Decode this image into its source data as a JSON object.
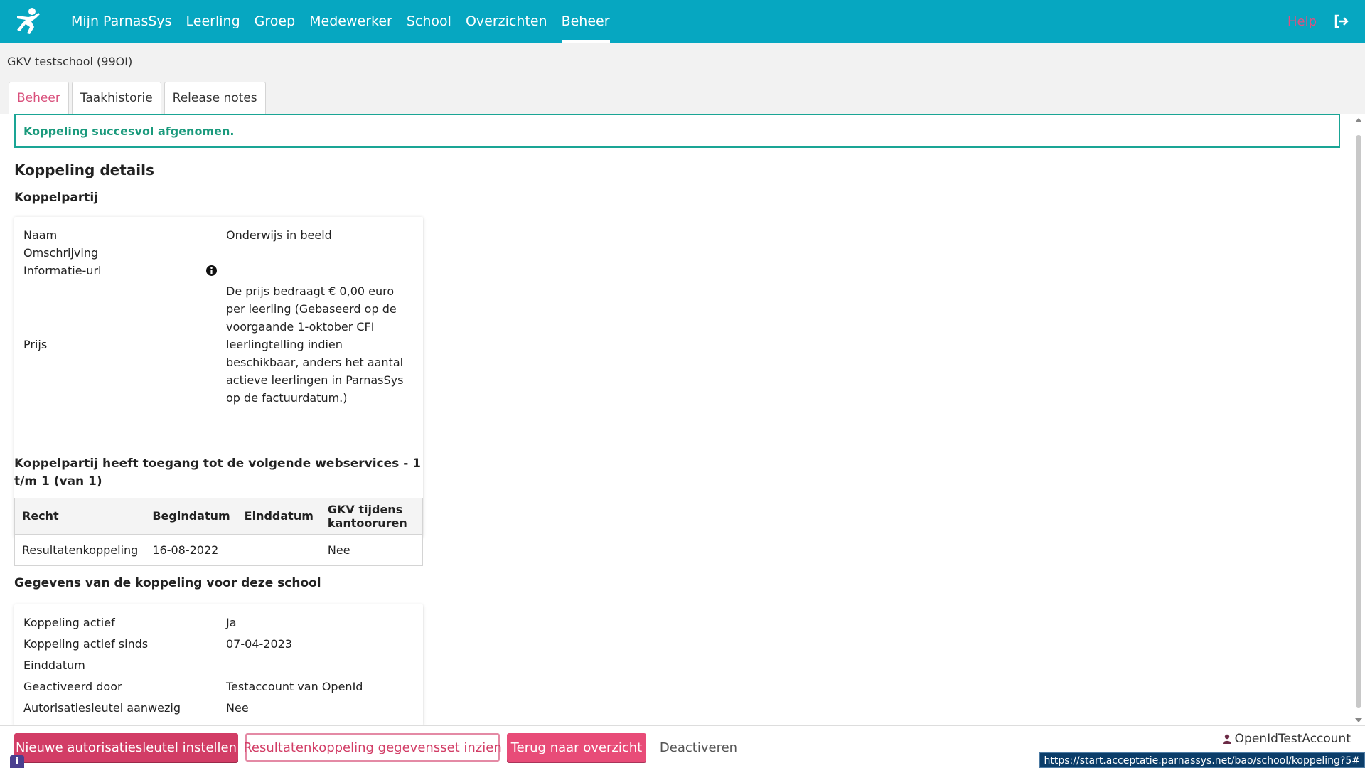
{
  "nav": {
    "items": [
      {
        "label": "Mijn ParnasSys",
        "active": false
      },
      {
        "label": "Leerling",
        "active": false
      },
      {
        "label": "Groep",
        "active": false
      },
      {
        "label": "Medewerker",
        "active": false
      },
      {
        "label": "School",
        "active": false
      },
      {
        "label": "Overzichten",
        "active": false
      },
      {
        "label": "Beheer",
        "active": true
      }
    ],
    "help_label": "Help"
  },
  "header": {
    "school_name": "GKV testschool (99OI)"
  },
  "tabs": [
    {
      "label": "Beheer",
      "active": true
    },
    {
      "label": "Taakhistorie",
      "active": false
    },
    {
      "label": "Release notes",
      "active": false
    }
  ],
  "alert": {
    "message": "Koppeling succesvol afgenomen."
  },
  "details": {
    "title": "Koppeling details",
    "koppelpartij_title": "Koppelpartij",
    "rows": {
      "naam_label": "Naam",
      "naam_value": "Onderwijs in beeld",
      "omschrijving_label": "Omschrijving",
      "omschrijving_value": "",
      "url_label": "Informatie-url",
      "prijs_label": "Prijs",
      "prijs_value": "De prijs bedraagt € 0,00 euro per leerling (Gebaseerd op de voorgaande 1-oktober CFI leerlingtelling indien beschikbaar, anders het aantal actieve leerlingen in ParnasSys op de factuurdatum.)"
    }
  },
  "webservices": {
    "title": "Koppelpartij heeft toegang tot de volgende webservices - 1 t/m 1 (van 1)",
    "columns": [
      "Recht",
      "Begindatum",
      "Einddatum",
      "GKV tijdens kantooruren"
    ],
    "rows": [
      {
        "recht": "Resultatenkoppeling",
        "begindatum": "16-08-2022",
        "einddatum": "",
        "gkv": "Nee"
      }
    ]
  },
  "school_data": {
    "title": "Gegevens van de koppeling voor deze school",
    "rows": [
      {
        "label": "Koppeling actief",
        "value": "Ja"
      },
      {
        "label": "Koppeling actief sinds",
        "value": "07-04-2023"
      },
      {
        "label": "Einddatum",
        "value": ""
      },
      {
        "label": "Geactiveerd door",
        "value": "Testaccount van OpenId"
      },
      {
        "label": "Autorisatiesleutel aanwezig",
        "value": "Nee"
      }
    ]
  },
  "footer": {
    "btn_new_key": "Nieuwe autorisatiesleutel instellen",
    "btn_dataset": "Resultatenkoppeling gegevensset inzien",
    "btn_back": "Terug naar overzicht",
    "btn_deactivate": "Deactiveren",
    "user_name": "OpenIdTestAccount",
    "status_url": "https://start.acceptatie.parnassys.net/bao/school/koppeling?5#",
    "corner_info": "i"
  },
  "colors": {
    "topbar": "#06a7c1",
    "accent": "#d23d66",
    "success": "#1aa595"
  }
}
